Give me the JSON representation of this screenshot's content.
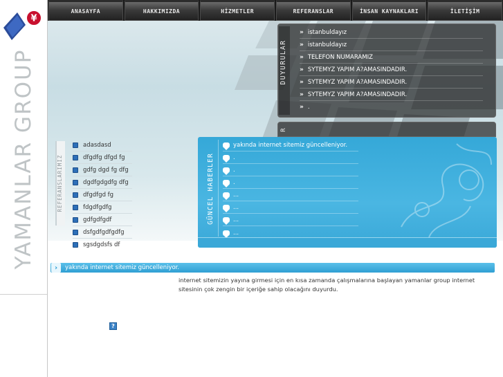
{
  "brand": {
    "name": "YAMANLAR GROUP",
    "logo_icon": "yen-coin-logo"
  },
  "nav": {
    "items": [
      {
        "label": "ANASAYFA"
      },
      {
        "label": "HAKKIMIZDA"
      },
      {
        "label": "HİZMETLER"
      },
      {
        "label": "REFERANSLAR"
      },
      {
        "label": "İNSAN KAYNAKLARI"
      },
      {
        "label": "İLETİŞİM"
      }
    ]
  },
  "announcements": {
    "title": "DUYURULAR",
    "second_title": "R",
    "items": [
      {
        "text": "istanbuldayız"
      },
      {
        "text": "istanbuldayız"
      },
      {
        "text": "TELEFON NUMARAMIZ"
      },
      {
        "text": "SYTEMYZ YAPIM A?AMASINDADIR."
      },
      {
        "text": "SYTEMYZ YAPIM A?AMASINDADIR."
      },
      {
        "text": "SYTEMYZ YAPIM A?AMASINDADIR."
      },
      {
        "text": "."
      }
    ]
  },
  "references": {
    "title": "REFERANSLARIMIZ",
    "items": [
      {
        "text": "adasdasd"
      },
      {
        "text": "dfgdfg dfgd fg"
      },
      {
        "text": "gdfg dgd fg dfg"
      },
      {
        "text": "dgdfgdgdfg dfg"
      },
      {
        "text": "dfgdfgd fg"
      },
      {
        "text": "fdgdfgdfg"
      },
      {
        "text": "gdfgdfgdf"
      },
      {
        "text": "dsfgdfgdfgdfg"
      },
      {
        "text": "sgsdgdsfs df"
      }
    ]
  },
  "news": {
    "title": "GÜNCEL HABERLER",
    "items": [
      {
        "text": "yakında internet sitemiz güncelleniyor."
      },
      {
        "text": "."
      },
      {
        "text": "."
      },
      {
        "text": "."
      },
      {
        "text": "..."
      },
      {
        "text": "..."
      },
      {
        "text": "..."
      },
      {
        "text": "..."
      }
    ]
  },
  "headline": {
    "text": "yakında internet sitemiz güncelleniyor."
  },
  "body": {
    "text": "internet sitemizin yayına girmesi için en kısa zamanda çalışmalarına başlayan yamanlar group internet sitesinin çok zengin bir içeriğe sahip olacağını duyurdu."
  },
  "help": {
    "label": "?"
  }
}
